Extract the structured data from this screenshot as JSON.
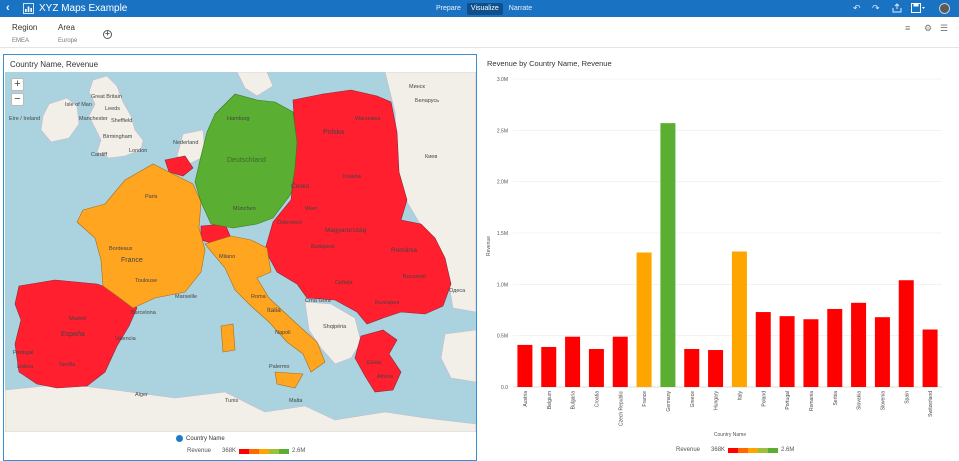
{
  "app": {
    "title": "XYZ Maps Example",
    "tabs": [
      {
        "label": "Prepare",
        "active": false
      },
      {
        "label": "Visualize",
        "active": true
      },
      {
        "label": "Narrate",
        "active": false
      }
    ]
  },
  "filters": [
    {
      "name": "Region",
      "value": "EMEA"
    },
    {
      "name": "Area",
      "value": "Europe"
    }
  ],
  "map_panel": {
    "title": "Country Name, Revenue",
    "legend_layer": "Country Name",
    "legend_measure": "Revenue",
    "legend_min": "368K",
    "legend_max": "2.6M",
    "zoom_in": "+",
    "zoom_out": "−",
    "labels": [
      {
        "text": "Isle of Man"
      },
      {
        "text": "Great Britain"
      },
      {
        "text": "Leeds"
      },
      {
        "text": "Manchester"
      },
      {
        "text": "Sheffield"
      },
      {
        "text": "Eire / Ireland"
      },
      {
        "text": "Birmingham"
      },
      {
        "text": "Cardiff"
      },
      {
        "text": "London"
      },
      {
        "text": "Nederland"
      },
      {
        "text": "Hamburg"
      },
      {
        "text": "Deutschland"
      },
      {
        "text": "Polska"
      },
      {
        "text": "Warszawa"
      },
      {
        "text": "Česko"
      },
      {
        "text": "Kraków"
      },
      {
        "text": "Österreich"
      },
      {
        "text": "Magyarország"
      },
      {
        "text": "România"
      },
      {
        "text": "France"
      },
      {
        "text": "Paris"
      },
      {
        "text": "Italia"
      },
      {
        "text": "Roma"
      },
      {
        "text": "España"
      },
      {
        "text": "Madrid"
      },
      {
        "text": "Portugal"
      },
      {
        "text": "Ελλάς"
      },
      {
        "text": "Shqipëria"
      },
      {
        "text": "Crna Gora"
      },
      {
        "text": "Србија"
      },
      {
        "text": "България"
      },
      {
        "text": "Киев"
      },
      {
        "text": "Минск"
      },
      {
        "text": "Беларусь"
      },
      {
        "text": "Bordeaux"
      },
      {
        "text": "Toulouse"
      },
      {
        "text": "Marseille"
      },
      {
        "text": "Barcelona"
      },
      {
        "text": "Valencia"
      },
      {
        "text": "Sevilla"
      },
      {
        "text": "Lisboa"
      },
      {
        "text": "Milano"
      },
      {
        "text": "München"
      },
      {
        "text": "Wien"
      },
      {
        "text": "Budapest"
      },
      {
        "text": "București"
      },
      {
        "text": "Athína"
      },
      {
        "text": "Napoli"
      },
      {
        "text": "Palermo"
      },
      {
        "text": "Tunis"
      },
      {
        "text": "Alger"
      },
      {
        "text": "Malta"
      },
      {
        "text": "Одеса"
      }
    ]
  },
  "chart": {
    "title": "Revenue by Country Name, Revenue",
    "legend_measure": "Revenue",
    "legend_min": "368K",
    "legend_max": "2.6M"
  },
  "chart_data": {
    "type": "bar",
    "title": "Revenue by Country Name, Revenue",
    "xlabel": "Country Name",
    "ylabel": "Revenue",
    "ylim": [
      0,
      3000000
    ],
    "yticks": [
      {
        "value": 0,
        "label": "0.0"
      },
      {
        "value": 500000,
        "label": "0.5M"
      },
      {
        "value": 1000000,
        "label": "1.0M"
      },
      {
        "value": 1500000,
        "label": "1.5M"
      },
      {
        "value": 2000000,
        "label": "2.0M"
      },
      {
        "value": 2500000,
        "label": "2.5M"
      },
      {
        "value": 3000000,
        "label": "3.0M"
      }
    ],
    "categories": [
      "Austria",
      "Belgium",
      "Bulgaria",
      "Croatia",
      "Czech Republic",
      "France",
      "Germany",
      "Greece",
      "Hungary",
      "Italy",
      "Poland",
      "Portugal",
      "Romania",
      "Serbia",
      "Slovakia",
      "Slovenia",
      "Spain",
      "Switzerland"
    ],
    "values": [
      410000,
      390000,
      490000,
      370000,
      490000,
      1310000,
      2570000,
      370000,
      360000,
      1320000,
      730000,
      690000,
      660000,
      760000,
      820000,
      680000,
      1040000,
      560000
    ],
    "colors": [
      "#ff0000",
      "#ff0000",
      "#ff0000",
      "#ff0000",
      "#ff0000",
      "#ffa500",
      "#5aae32",
      "#ff0000",
      "#ff0000",
      "#ffa500",
      "#ff0000",
      "#ff0000",
      "#ff0000",
      "#ff0000",
      "#ff0000",
      "#ff0000",
      "#ff0000",
      "#ff0000"
    ],
    "grid": true,
    "legend": "bottom"
  },
  "colors": {
    "topbar": "#1a73c2",
    "low": "#ff0000",
    "mid": "#ffa500",
    "high": "#5aae32",
    "sea": "#aad3df",
    "land": "#f2efe9"
  }
}
